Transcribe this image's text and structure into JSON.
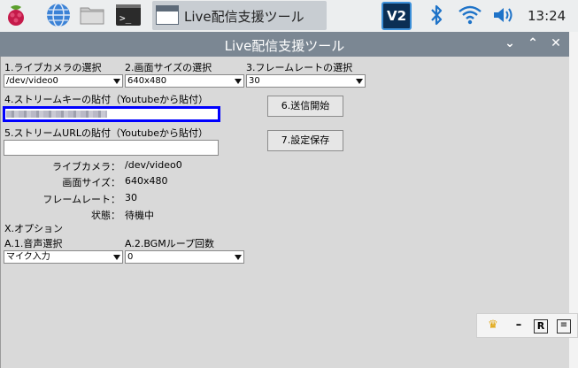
{
  "taskbar": {
    "app_button_label": "Live配信支援ツール",
    "clock": "13:24",
    "vnc_label": "V2"
  },
  "window": {
    "title": "Live配信支援ツール",
    "controls": {
      "minimize": "⌄",
      "maximize": "⌃",
      "close": "✕"
    }
  },
  "form": {
    "camera_label": "1.ライブカメラの選択",
    "camera_value": "/dev/video0",
    "size_label": "2.画面サイズの選択",
    "size_value": "640x480",
    "framerate_label": "3.フレームレートの選択",
    "framerate_value": "30",
    "stream_key_label": "4.ストリームキーの貼付（Youtubeから貼付）",
    "stream_key_value": "",
    "stream_url_label": "5.ストリームURLの貼付（Youtubeから貼付）",
    "stream_url_value": "",
    "start_button": "6.送信開始",
    "save_button": "7.設定保存"
  },
  "status": {
    "camera_label": "ライブカメラ：",
    "camera_value": "/dev/video0",
    "size_label": "画面サイズ：",
    "size_value": "640x480",
    "framerate_label": "フレームレート：",
    "framerate_value": "30",
    "state_label": "状態：",
    "state_value": "待機中"
  },
  "options": {
    "header": "X.オプション",
    "audio_label": "A.1.音声選択",
    "audio_value": "マイク入力",
    "bgm_label": "A.2.BGMループ回数",
    "bgm_value": "0"
  },
  "colors": {
    "titlebar": "#7b8793",
    "focus_border": "#0000ff",
    "accent_blue": "#1e73c8"
  }
}
